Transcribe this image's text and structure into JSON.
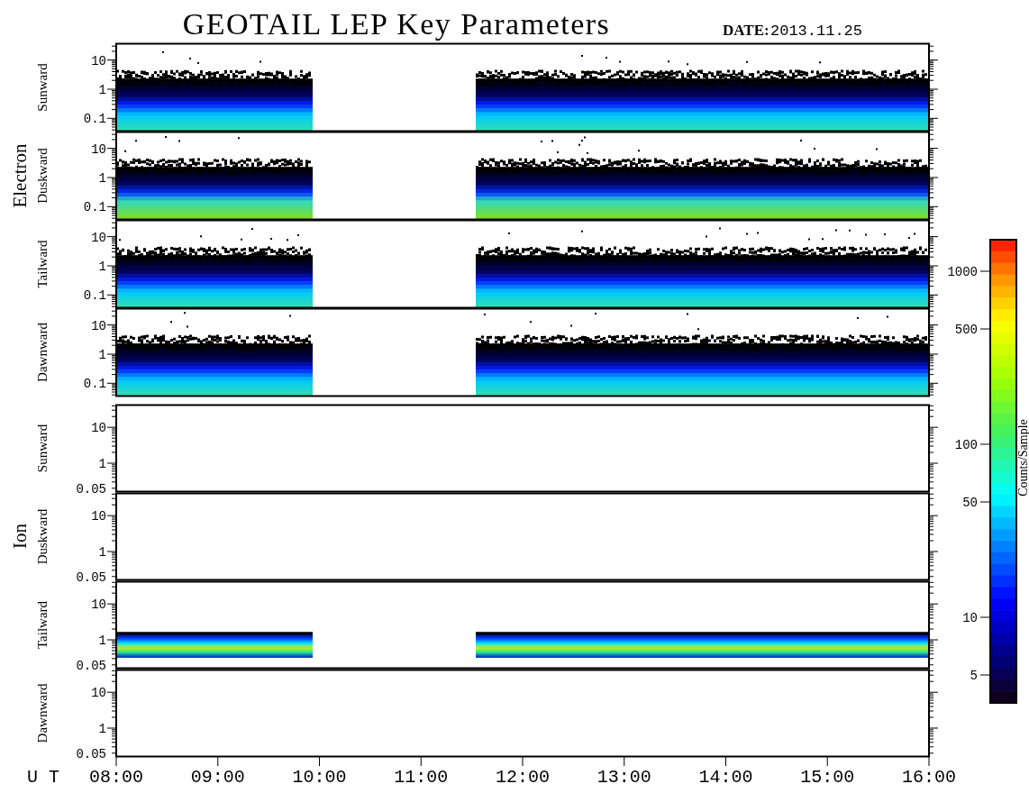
{
  "title": "GEOTAIL LEP Key Parameters",
  "date_label": "DATE:",
  "date": "2013.11.25",
  "groups": [
    {
      "label": "Electron",
      "panels": [
        {
          "label": "Sunward",
          "has_data": true,
          "yticks": [
            "10",
            "1",
            "0.1"
          ]
        },
        {
          "label": "Duskward",
          "has_data": true,
          "yticks": [
            "10",
            "1",
            "0.1"
          ]
        },
        {
          "label": "Tailward",
          "has_data": true,
          "yticks": [
            "10",
            "1",
            "0.1"
          ]
        },
        {
          "label": "Dawnward",
          "has_data": true,
          "yticks": [
            "10",
            "1",
            "0.1"
          ]
        }
      ]
    },
    {
      "label": "Ion",
      "panels": [
        {
          "label": "Sunward",
          "has_data": false,
          "yticks": [
            "10",
            "1",
            "0.05"
          ]
        },
        {
          "label": "Duskward",
          "has_data": false,
          "yticks": [
            "10",
            "1",
            "0.05"
          ]
        },
        {
          "label": "Tailward",
          "has_data": true,
          "yticks": [
            "10",
            "1",
            "0.05"
          ]
        },
        {
          "label": "Dawnward",
          "has_data": false,
          "yticks": [
            "10",
            "1",
            "0.05"
          ]
        }
      ]
    }
  ],
  "x_axis": {
    "label": "U T",
    "ticks": [
      "08:00",
      "09:00",
      "10:00",
      "11:00",
      "12:00",
      "13:00",
      "14:00",
      "15:00",
      "16:00"
    ]
  },
  "colorbar": {
    "label": "Counts/Sample",
    "ticks": [
      "1000",
      "500",
      "100",
      "50",
      "10",
      "5"
    ]
  }
}
